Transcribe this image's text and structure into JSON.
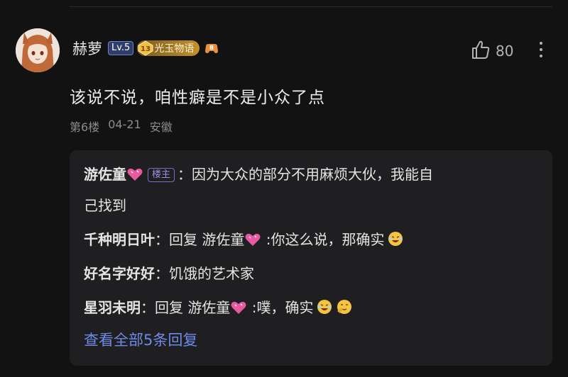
{
  "comment": {
    "username": "赫萝",
    "level": "Lv.5",
    "fan_badge": {
      "level": "13",
      "name": "光玉物语"
    },
    "likes": "80",
    "text": "该说不说，咱性癖是不是小众了点",
    "floor": "第6楼",
    "date": "04-21",
    "location": "安徽"
  },
  "replies": [
    {
      "name": "游佐童",
      "tag": "楼主",
      "prefix": "：",
      "text": "因为大众的部分不用麻烦大伙，我能自",
      "text2": "己找到"
    },
    {
      "name": "千种明日叶",
      "reply_word": "：回复 ",
      "target": "游佐童",
      "text": " :你这么说，那确实"
    },
    {
      "name": "好名字好好",
      "text": "：饥饿的艺术家"
    },
    {
      "name": "星羽未明",
      "reply_word": "：回复 ",
      "target": "游佐童",
      "text": " :噗，确实"
    }
  ],
  "view_all": "查看全部5条回复",
  "icons": [
    "thumb-up-icon",
    "more-vertical-icon",
    "heart-icon",
    "laugh-emoji",
    "facepalm-emoji"
  ],
  "colors": {
    "background": "#121212",
    "reply_box": "#1f1f21",
    "link": "#6e8ae8",
    "tag": "#9e8ee6"
  }
}
